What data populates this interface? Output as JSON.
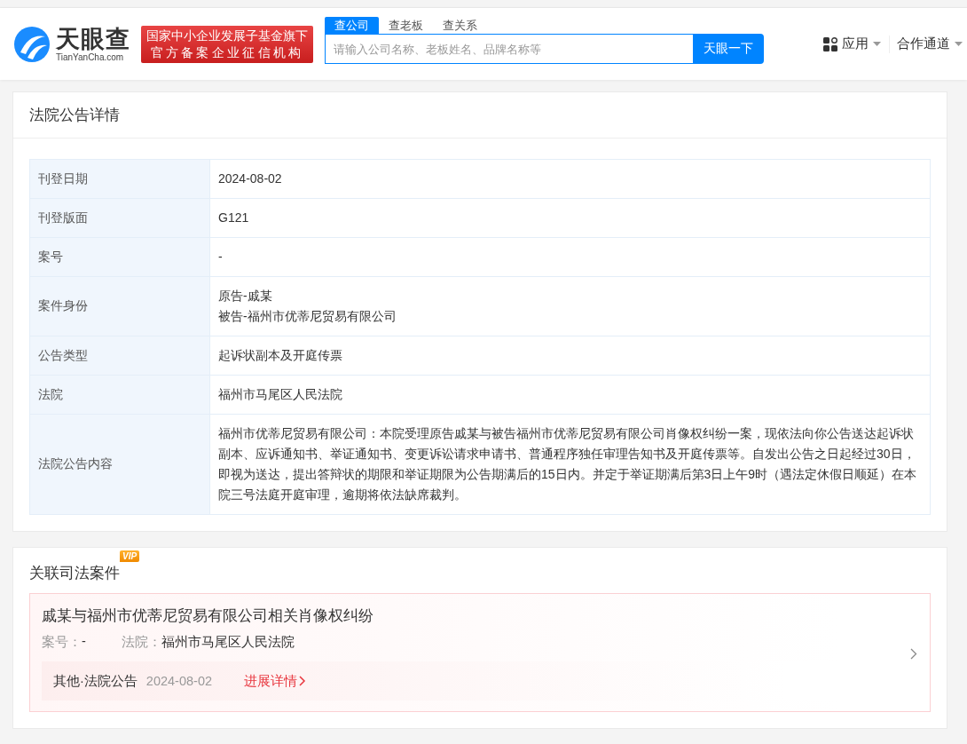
{
  "header": {
    "logo": {
      "name": "天眼查",
      "domain": "TianYanCha.com"
    },
    "badge": [
      "国家中小企业发展子基金旗下",
      "官方备案企业征信机构"
    ],
    "search_tabs": [
      {
        "label": "查公司",
        "selected": true
      },
      {
        "label": "查老板",
        "selected": false
      },
      {
        "label": "查关系",
        "selected": false
      }
    ],
    "search": {
      "placeholder": "请输入公司名称、老板姓名、品牌名称等",
      "button": "天眼一下"
    },
    "nav": [
      {
        "label": "应用",
        "kind": "apps"
      },
      {
        "label": "合作通道",
        "kind": "plain"
      }
    ]
  },
  "notice": {
    "title": "法院公告详情",
    "rows": [
      {
        "label": "刊登日期",
        "lines": [
          "2024-08-02"
        ]
      },
      {
        "label": "刊登版面",
        "lines": [
          "G121"
        ]
      },
      {
        "label": "案号",
        "lines": [
          "-"
        ]
      },
      {
        "label": "案件身份",
        "lines": [
          "原告-戚某",
          "被告-福州市优蒂尼贸易有限公司"
        ]
      },
      {
        "label": "公告类型",
        "lines": [
          "起诉状副本及开庭传票"
        ]
      },
      {
        "label": "法院",
        "lines": [
          "福州市马尾区人民法院"
        ]
      },
      {
        "label": "法院公告内容",
        "lines": [
          "福州市优蒂尼贸易有限公司：本院受理原告戚某与被告福州市优蒂尼贸易有限公司肖像权纠纷一案，现依法向你公告送达起诉状副本、应诉通知书、举证通知书、变更诉讼请求申请书、普通程序独任审理告知书及开庭传票等。自发出公告之日起经过30日，即视为送达，提出答辩状的期限和举证期限为公告期满后的15日内。并定于举证期满后第3日上午9时（遇法定休假日顺延）在本院三号法庭开庭审理，逾期将依法缺席裁判。"
        ]
      }
    ]
  },
  "related": {
    "title": "关联司法案件",
    "badge": "VIP",
    "cases": [
      {
        "title": "戚某与福州市优蒂尼贸易有限公司相关肖像权纠纷",
        "case_no_label": "案号：",
        "case_no": "-",
        "court_label": "法院：",
        "court": "福州市马尾区人民法院",
        "type": "其他·法院公告",
        "date": "2024-08-02",
        "link": "进展详情"
      }
    ]
  }
}
